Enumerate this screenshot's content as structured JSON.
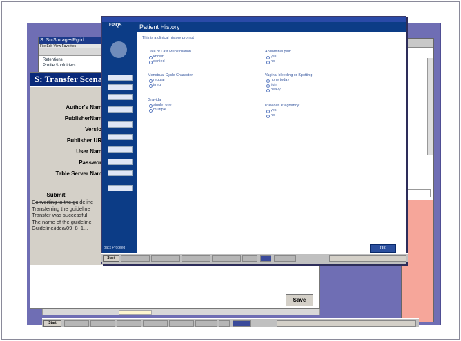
{
  "explorer_window": {
    "title": "S: SrcStoragesRgrid",
    "menu": "File Edit View Favorites",
    "tree": [
      "Retentions",
      "Profile Subfolders"
    ]
  },
  "form_window": {
    "title": "S: Transfer Scenario",
    "fields": [
      {
        "label": "Author's Name"
      },
      {
        "label": "PublisherName"
      },
      {
        "label": "Version"
      },
      {
        "label": "Publisher URL"
      },
      {
        "label": "User Name"
      },
      {
        "label": "Password"
      },
      {
        "label": "Table Server Name"
      }
    ],
    "submit_label": "Submit",
    "log_lines": [
      "Converting to the guideline",
      "Transferring the guideline",
      "Transfer was successful",
      "The name of the guideline",
      "  Guideline/idea/09_8_1..."
    ],
    "save_label": "Save"
  },
  "dialog": {
    "brand": "EPIQS",
    "title": "Patient History",
    "intro": "This is a clinical history prompt",
    "groups": [
      {
        "header": "Date of Last Menstruation",
        "options": [
          "known",
          "denied"
        ]
      },
      {
        "header": "Abdominal pain",
        "options": [
          "yes",
          "no"
        ]
      },
      {
        "header": "Menstrual Cycle Character",
        "options": [
          "regular",
          "irreg"
        ]
      },
      {
        "header": "Vaginal bleeding or Spotting",
        "options": [
          "none today",
          "light",
          "heavy"
        ]
      },
      {
        "header": "Gravida",
        "options": [
          "single_one",
          "multiple"
        ]
      },
      {
        "header": "Previous Pregnancy",
        "options": [
          "yes",
          "no"
        ]
      }
    ],
    "ok_label": "OK",
    "footer": "Back Proceed"
  },
  "taskbar_main": {
    "start_label": "Start"
  },
  "taskbar_bottom": {
    "start_label": "Start"
  }
}
